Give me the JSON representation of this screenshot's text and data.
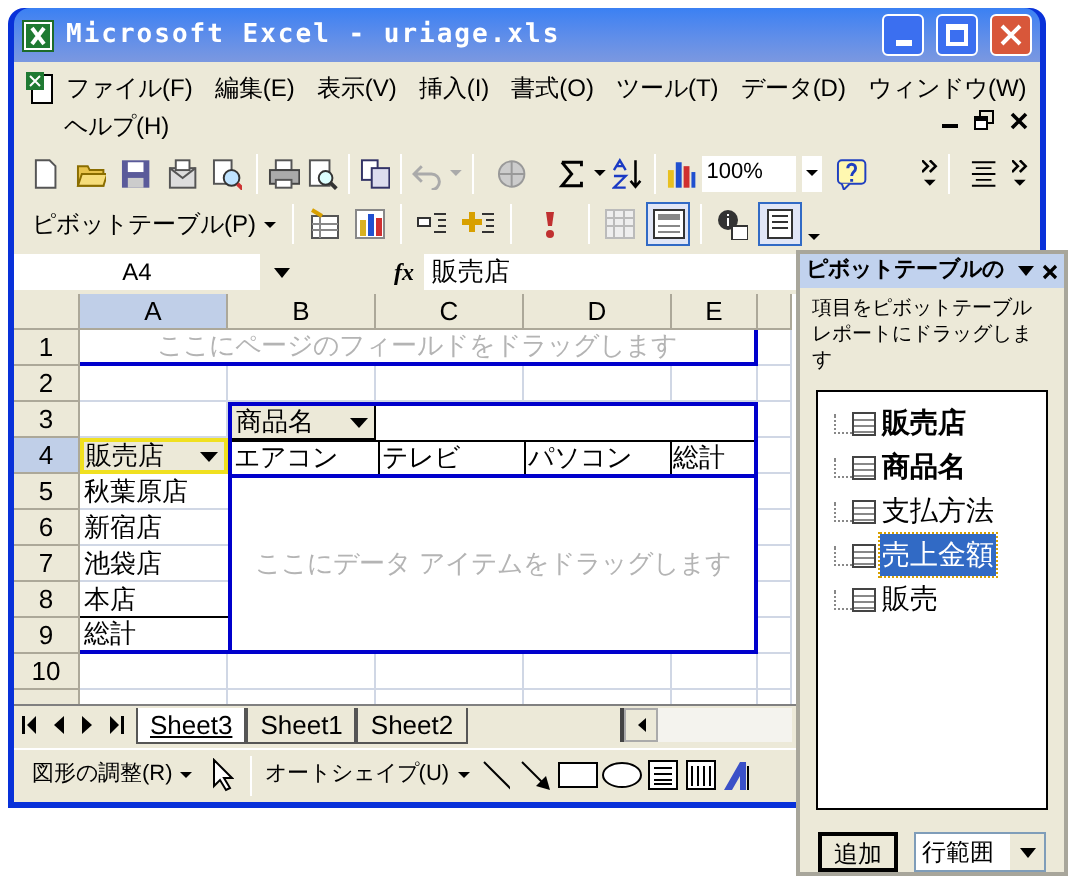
{
  "window": {
    "title": "Microsoft Excel - uriage.xls"
  },
  "menu": [
    "ファイル(F)",
    "編集(E)",
    "表示(V)",
    "挿入(I)",
    "書式(O)",
    "ツール(T)",
    "データ(D)",
    "ウィンドウ(W)",
    "ヘルプ(H)"
  ],
  "standard_toolbar": {
    "zoom": "100%"
  },
  "pivot_toolbar": {
    "label": "ピボットテーブル(P)"
  },
  "formula_bar": {
    "name_box": "A4",
    "function_label": "fx",
    "formula": "販売店"
  },
  "sheet": {
    "columns": [
      {
        "label": "A",
        "selected": true
      },
      {
        "label": "B",
        "selected": false
      },
      {
        "label": "C",
        "selected": false
      },
      {
        "label": "D",
        "selected": false
      },
      {
        "label": "E",
        "selected": false
      }
    ],
    "rows": [
      {
        "label": "1",
        "selected": false
      },
      {
        "label": "2",
        "selected": false
      },
      {
        "label": "3",
        "selected": false
      },
      {
        "label": "4",
        "selected": true
      },
      {
        "label": "5",
        "selected": false
      },
      {
        "label": "6",
        "selected": false
      },
      {
        "label": "7",
        "selected": false
      },
      {
        "label": "8",
        "selected": false
      },
      {
        "label": "9",
        "selected": false
      },
      {
        "label": "10",
        "selected": false
      }
    ]
  },
  "pivot_table": {
    "page_hint": "ここにページのフィールドをドラッグします",
    "column_field": "商品名",
    "row_field": "販売店",
    "column_items": [
      "エアコン",
      "テレビ",
      "パソコン",
      "総計"
    ],
    "row_items": [
      "秋葉原店",
      "新宿店",
      "池袋店",
      "本店",
      "総計"
    ],
    "data_hint": "ここにデータ アイテムをドラッグします"
  },
  "sheet_tabs": [
    {
      "label": "Sheet3",
      "selected": true
    },
    {
      "label": "Sheet1",
      "selected": false
    },
    {
      "label": "Sheet2",
      "selected": false
    }
  ],
  "drawing_toolbar": {
    "draw_menu": "図形の調整(R)",
    "autoshapes_menu": "オートシェイプ(U)"
  },
  "pivot_panel": {
    "title": "ピボットテーブルの",
    "instruction": "項目をピボットテーブルレポートにドラッグします",
    "fields": [
      {
        "label": "販売店",
        "in_report": true,
        "selected": false
      },
      {
        "label": "商品名",
        "in_report": true,
        "selected": false
      },
      {
        "label": "支払方法",
        "in_report": false,
        "selected": false
      },
      {
        "label": "売上金額",
        "in_report": false,
        "selected": true
      },
      {
        "label": "販売",
        "in_report": false,
        "selected": false
      }
    ],
    "add_button": "追加",
    "area": "行範囲"
  }
}
